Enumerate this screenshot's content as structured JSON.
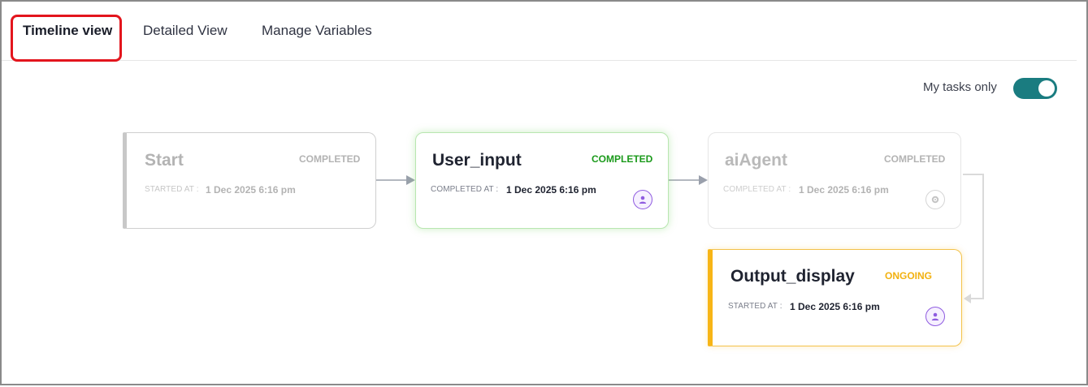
{
  "tabs": [
    {
      "label": "Timeline view",
      "active": true
    },
    {
      "label": "Detailed View",
      "active": false
    },
    {
      "label": "Manage Variables",
      "active": false
    }
  ],
  "filter": {
    "label": "My tasks only",
    "enabled": true,
    "color": "#1a7c80"
  },
  "nodes": [
    {
      "title": "Start",
      "status": "COMPLETED",
      "meta_label": "STARTED AT :",
      "meta_value": "1 Dec 2025 6:16 pm",
      "icon": "none"
    },
    {
      "title": "User_input",
      "status": "COMPLETED",
      "meta_label": "COMPLETED AT :",
      "meta_value": "1 Dec 2025 6:16 pm",
      "icon": "user-icon",
      "status_color": "#1b9a1b"
    },
    {
      "title": "aiAgent",
      "status": "COMPLETED",
      "meta_label": "COMPLETED AT :",
      "meta_value": "1 Dec 2025 6:16 pm",
      "icon": "gear-icon"
    },
    {
      "title": "Output_display",
      "status": "ONGOING",
      "meta_label": "STARTED AT :",
      "meta_value": "1 Dec 2025 6:16 pm",
      "icon": "user-icon",
      "status_color": "#f2b10f"
    }
  ]
}
